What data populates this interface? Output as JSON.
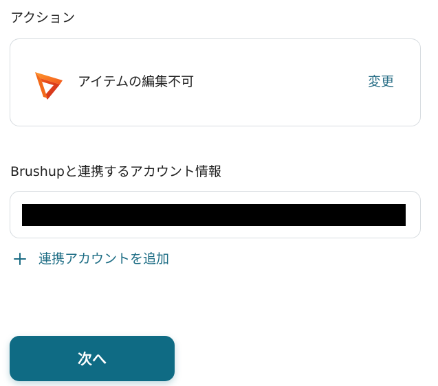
{
  "action_section": {
    "label": "アクション",
    "action_name": "アイテムの編集不可",
    "change_label": "変更",
    "app_icon": "brushup-logo-icon"
  },
  "account_section": {
    "label": "Brushupと連携するアカウント情報",
    "selected_account": "",
    "add_account_label": "連携アカウントを追加",
    "add_icon": "plus-icon"
  },
  "footer": {
    "next_label": "次へ"
  },
  "colors": {
    "accent": "#0f6b84",
    "link": "#2a6f87",
    "border": "#d6dbdf",
    "logo_orange": "#f26a1b",
    "logo_red": "#e0341c"
  }
}
